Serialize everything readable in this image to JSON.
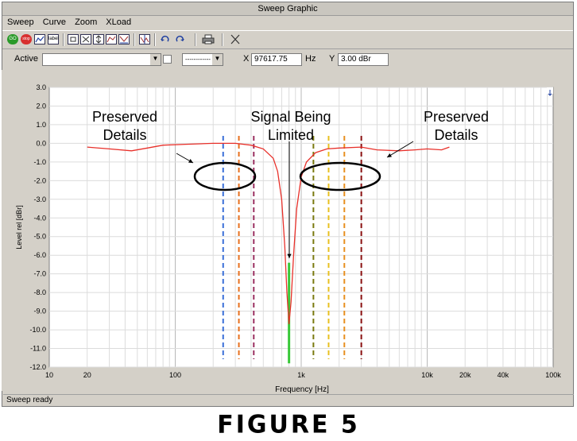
{
  "window": {
    "title": "Sweep Graphic"
  },
  "menu": {
    "items": [
      "Sweep",
      "Curve",
      "Zoom",
      "XLoad"
    ]
  },
  "toolbar": {
    "go_label": "GO",
    "stop_label": "stop",
    "label_button": "label"
  },
  "controls": {
    "active_label": "Active",
    "active_value": "",
    "line_style_value": "------------",
    "x_label": "X",
    "x_value": "97617.75",
    "x_unit": "Hz",
    "y_label": "Y",
    "y_value": "3.00 dBr"
  },
  "chart_data": {
    "type": "line",
    "xlabel": "Frequency [Hz]",
    "ylabel": "Level rel [dBr]",
    "xscale": "log",
    "xlim": [
      10,
      100000
    ],
    "ylim": [
      -12,
      3
    ],
    "grid": true,
    "x_ticks": [
      "10",
      "20",
      "100",
      "1k",
      "10k",
      "20k",
      "40k",
      "100k"
    ],
    "y_ticks": [
      "3.0",
      "2.0",
      "1.0",
      "0.0",
      "-1.0",
      "-2.0",
      "-3.0",
      "-4.0",
      "-5.0",
      "-6.0",
      "-7.0",
      "-8.0",
      "-9.0",
      "-10.0",
      "-11.0",
      "-12.0"
    ],
    "series": [
      {
        "color": "#e8302a",
        "x": [
          20,
          30,
          45,
          60,
          80,
          120,
          200,
          300,
          400,
          500,
          600,
          650,
          700,
          740,
          770,
          800,
          830,
          870,
          920,
          1000,
          1100,
          1300,
          1600,
          2000,
          3000,
          4000,
          6000,
          8000,
          10000,
          13000,
          15000
        ],
        "y": [
          -0.2,
          -0.3,
          -0.4,
          -0.25,
          -0.1,
          -0.05,
          0.0,
          0.0,
          -0.1,
          -0.3,
          -0.8,
          -1.5,
          -3.0,
          -5.5,
          -8.0,
          -9.7,
          -8.5,
          -6.0,
          -3.5,
          -1.8,
          -1.0,
          -0.5,
          -0.3,
          -0.25,
          -0.2,
          -0.35,
          -0.4,
          -0.35,
          -0.3,
          -0.35,
          -0.2
        ]
      }
    ],
    "markers": [
      {
        "x": 240,
        "color": "#3a6fd8"
      },
      {
        "x": 320,
        "color": "#e8701e"
      },
      {
        "x": 420,
        "color": "#9a3060"
      },
      {
        "x": 800,
        "color": "#39c839"
      },
      {
        "x": 1250,
        "color": "#7a7a10"
      },
      {
        "x": 1650,
        "color": "#e8c020"
      },
      {
        "x": 2200,
        "color": "#e89020"
      },
      {
        "x": 3000,
        "color": "#8a1010"
      }
    ],
    "limit_segment": {
      "x": 800,
      "y_from": -6.4,
      "y_to": -11.8,
      "color": "#39c839"
    },
    "annotations": [
      {
        "id": "left",
        "text": [
          "Preserved",
          "Details"
        ]
      },
      {
        "id": "center",
        "text": [
          "Signal Being",
          "Limited"
        ]
      },
      {
        "id": "right",
        "text": [
          "Preserved",
          "Details"
        ]
      }
    ]
  },
  "status": {
    "text": "Sweep ready"
  },
  "figure_caption": "FIGURE 5"
}
